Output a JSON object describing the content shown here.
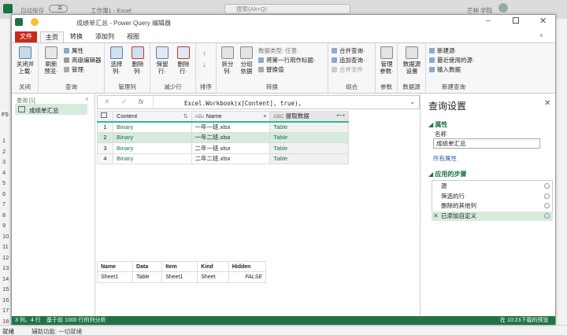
{
  "excel": {
    "autosave": "自动保存",
    "autosave_state": "关",
    "workbook": "工作簿1 - Excel",
    "search": "搜索(Alt+Q)",
    "user": "芒种 学院",
    "status_ready": "就绪",
    "accessibility": "辅助功能: 一切就绪",
    "namebox": "F5",
    "row_numbers": [
      "1",
      "2",
      "3",
      "4",
      "5",
      "6",
      "7",
      "8",
      "9",
      "10",
      "11",
      "12",
      "13",
      "14",
      "15",
      "16",
      "17",
      "18",
      "19",
      "20"
    ]
  },
  "pq": {
    "title": "成绩单汇总 - Power Query 编辑器",
    "tabs": {
      "file": "文件",
      "home": "主页",
      "transform": "转换",
      "addcol": "添加列",
      "view": "视图"
    },
    "ribbon": {
      "close": {
        "close_load": "关闭并\n上载·",
        "group": "关闭"
      },
      "query": {
        "refresh": "刷新\n预览·",
        "properties": "属性",
        "adv_editor": "高级编辑器",
        "manage": "管理·",
        "group": "查询"
      },
      "manage_cols": {
        "choose": "选择\n列·",
        "remove": "删除\n列·",
        "group": "管理列"
      },
      "reduce_rows": {
        "keep": "保留\n行·",
        "remove": "删除\n行·",
        "group": "减少行"
      },
      "sort": {
        "group": "排序"
      },
      "transform": {
        "split": "拆分\n列·",
        "groupby": "分组\n依据",
        "datatype": "数据类型: 任意·",
        "first_row": "将第一行用作标题·",
        "replace": "替换值",
        "group": "转换"
      },
      "combine": {
        "merge": "合并查询·",
        "append": "追加查询·",
        "combine_files": "合并文件",
        "group": "组合"
      },
      "params": {
        "manage": "管理\n参数·",
        "group": "参数"
      },
      "datasource": {
        "settings": "数据源\n设置",
        "group": "数据源"
      },
      "newquery": {
        "new_source": "新建源·",
        "recent": "最近使用的源·",
        "enter": "输入数据",
        "group": "新建查询"
      }
    },
    "queries_header": "查询 [1]",
    "query_item": "成绩单汇总",
    "formula_text": "Excel.Workbook(x[Content], true),",
    "formula_fx": "fx",
    "grid": {
      "col_content": "Content",
      "col_name": "Name",
      "col_custom": "提取数据",
      "rows": [
        {
          "n": "1",
          "content": "Binary",
          "name": "一年一班.xlsx",
          "custom": "Table"
        },
        {
          "n": "2",
          "content": "Binary",
          "name": "一年二班.xlsx",
          "custom": "Table"
        },
        {
          "n": "3",
          "content": "Binary",
          "name": "二年一班.xlsx",
          "custom": "Table"
        },
        {
          "n": "4",
          "content": "Binary",
          "name": "二年二班.xlsx",
          "custom": "Table"
        }
      ]
    },
    "preview": {
      "headers": [
        "Name",
        "Data",
        "Item",
        "Kind",
        "Hidden"
      ],
      "row": [
        "Sheet1",
        "Table",
        "Sheet1",
        "Sheet",
        "FALSE"
      ]
    },
    "settings": {
      "title": "查询设置",
      "props": "属性",
      "name_label": "名称",
      "name_value": "成绩单汇总",
      "all_props": "所有属性",
      "steps_title": "应用的步骤",
      "steps": [
        "源",
        "筛选的行",
        "删除的其他列",
        "已添加自定义"
      ]
    },
    "status": {
      "left": "3 列、4 行",
      "profile": "基于前 1000 行的列分析",
      "right": "在 10:23下载的预览"
    }
  }
}
